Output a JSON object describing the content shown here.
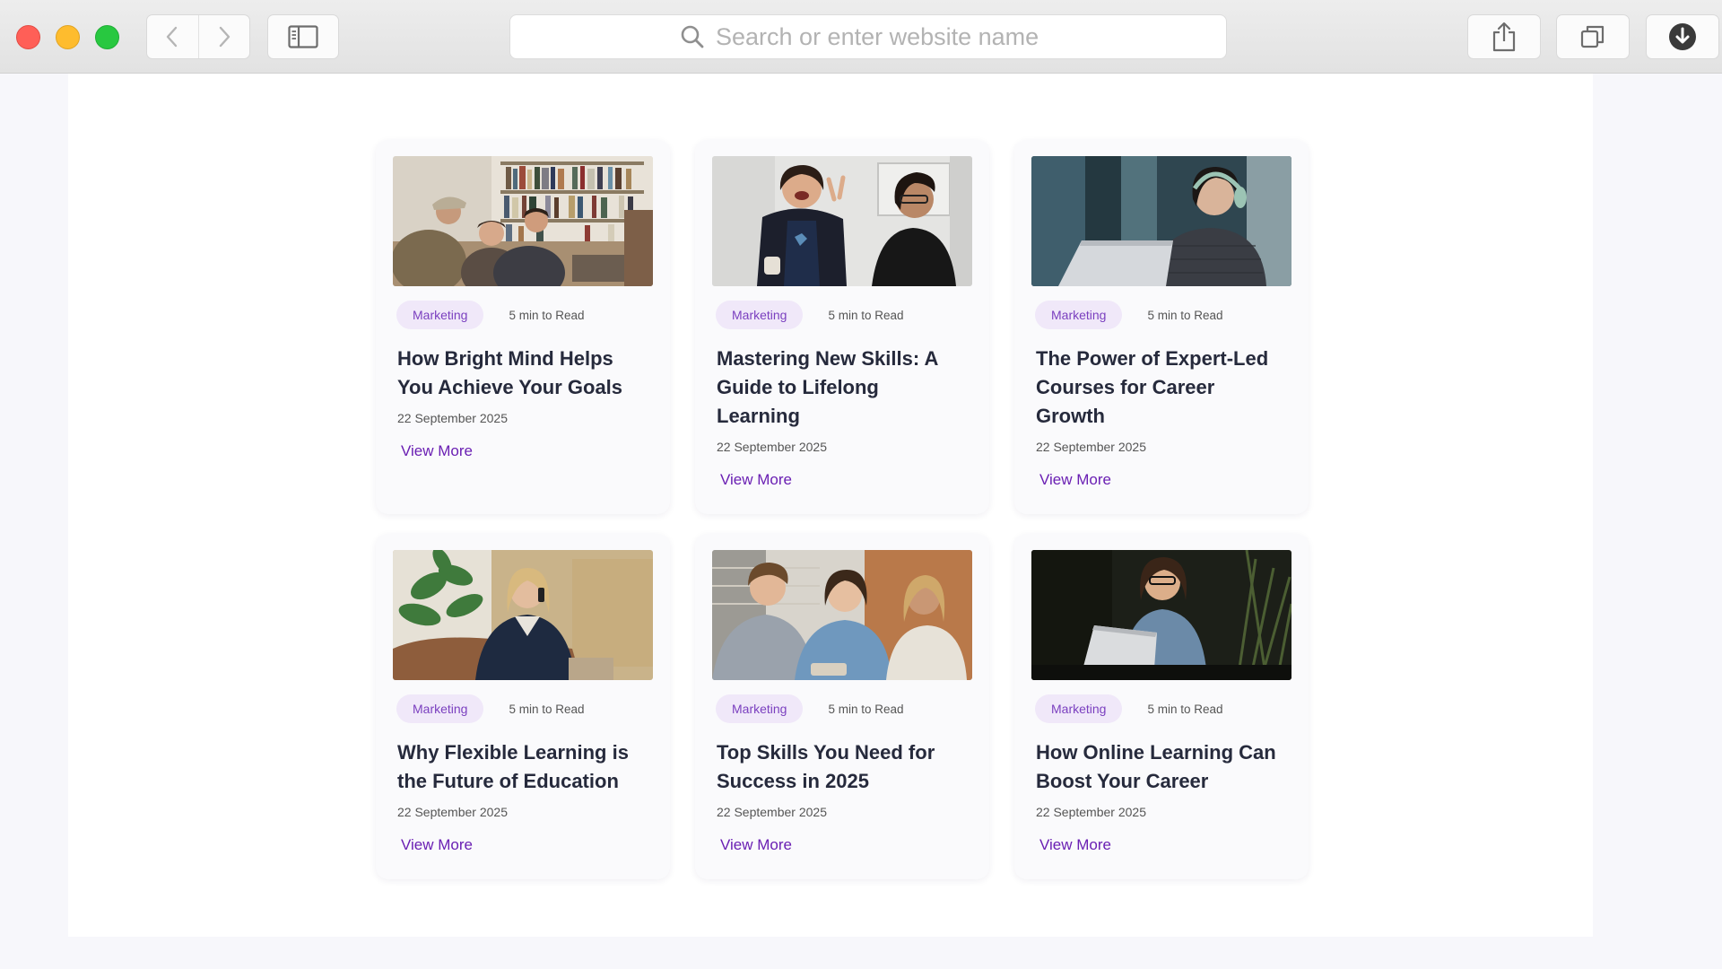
{
  "browser": {
    "search": {
      "placeholder": "Search or enter website name"
    }
  },
  "colors": {
    "accent": "#6a1fb3",
    "tag_background": "#f0e8f9",
    "tag_text": "#7a3fbf",
    "title_text": "#262a3c"
  },
  "articles": [
    {
      "tag": "Marketing",
      "read_time": "5 min to Read",
      "title": "How Bright Mind Helps You Achieve Your Goals",
      "date": "22 September 2025",
      "link": "View More",
      "image": "group-study-library-photo"
    },
    {
      "tag": "Marketing",
      "read_time": "5 min to Read",
      "title": "Mastering New Skills: A Guide to Lifelong Learning",
      "date": "22 September 2025",
      "link": "View More",
      "image": "happy-students-peace-sign-photo"
    },
    {
      "tag": "Marketing",
      "read_time": "5 min to Read",
      "title": "The Power of Expert-Led Courses for Career Growth",
      "date": "22 September 2025",
      "link": "View More",
      "image": "student-headphones-laptop-photo"
    },
    {
      "tag": "Marketing",
      "read_time": "5 min to Read",
      "title": "Why Flexible Learning is the Future of Education",
      "date": "22 September 2025",
      "link": "View More",
      "image": "woman-phone-sofa-photo"
    },
    {
      "tag": "Marketing",
      "read_time": "5 min to Read",
      "title": "Top Skills You Need for Success in 2025",
      "date": "22 September 2025",
      "link": "View More",
      "image": "friends-studying-together-photo"
    },
    {
      "tag": "Marketing",
      "read_time": "5 min to Read",
      "title": "How Online Learning Can Boost Your Career",
      "date": "22 September 2025",
      "link": "View More",
      "image": "woman-laptop-smiling-photo"
    }
  ]
}
